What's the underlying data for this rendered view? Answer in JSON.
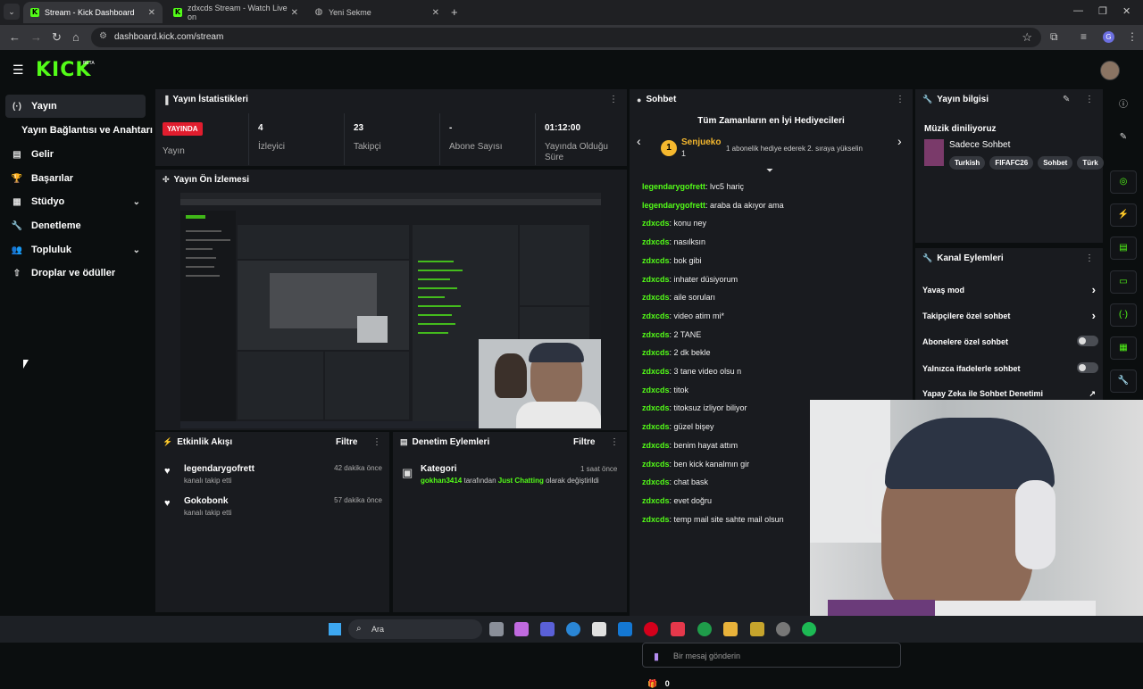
{
  "browser": {
    "tabs": [
      {
        "title": "Stream - Kick Dashboard",
        "active": true
      },
      {
        "title": "zdxcds Stream - Watch Live on",
        "active": false
      },
      {
        "title": "Yeni Sekme",
        "active": false
      }
    ],
    "url": "dashboard.kick.com/stream",
    "profile_initial": "G"
  },
  "brand": {
    "logo": "KICK",
    "beta": "BETA"
  },
  "sidebar": {
    "items": [
      {
        "label": "Yayın",
        "icon": "(·)"
      },
      {
        "label": "Yayın Bağlantısı ve Anahtarı",
        "icon": ""
      },
      {
        "label": "Gelir",
        "icon": "▤"
      },
      {
        "label": "Başarılar",
        "icon": "🏆"
      },
      {
        "label": "Stüdyo",
        "icon": "▦"
      },
      {
        "label": "Denetleme",
        "icon": "🔧"
      },
      {
        "label": "Topluluk",
        "icon": "👥"
      },
      {
        "label": "Droplar ve ödüller",
        "icon": "⇧"
      }
    ]
  },
  "stats": {
    "title": "Yayın İstatistikleri",
    "live_badge": "YAYINDA",
    "live_label": "Yayın",
    "items": [
      {
        "value": "4",
        "label": "İzleyici"
      },
      {
        "value": "23",
        "label": "Takipçi"
      },
      {
        "value": "-",
        "label": "Abone Sayısı"
      },
      {
        "value": "01:12:00",
        "label": "Yayında Olduğu Süre"
      }
    ]
  },
  "preview": {
    "title": "Yayın Ön İzlemesi"
  },
  "activity": {
    "title": "Etkinlik Akışı",
    "filter": "Filtre",
    "items": [
      {
        "name": "legendarygofrett",
        "sub": "kanalı takip etti",
        "time": "42 dakika önce"
      },
      {
        "name": "Gokobonk",
        "sub": "kanalı takip etti",
        "time": "57 dakika önce"
      }
    ]
  },
  "moderation": {
    "title": "Denetim Eylemleri",
    "filter": "Filtre",
    "item": {
      "label": "Kategori",
      "time": "1 saat önce",
      "user": "gokhan3414",
      "middle": "tarafından",
      "category": "Just Chatting",
      "suffix": "olarak değiştirildi"
    }
  },
  "chat": {
    "title": "Sohbet",
    "top_gifters": "Tüm Zamanların en İyi Hediyecileri",
    "gifter": {
      "rank": "1",
      "name": "Senjueko",
      "count": "1"
    },
    "gifter_msg": "1 abonelik hediye ederek 2. sıraya yükselin",
    "messages": [
      {
        "user": "legendarygofrett",
        "text": "lvc5 hariç"
      },
      {
        "user": "legendarygofrett",
        "text": "araba da akıyor ama"
      },
      {
        "user": "zdxcds",
        "text": "konu ney"
      },
      {
        "user": "zdxcds",
        "text": "nasılksın"
      },
      {
        "user": "zdxcds",
        "text": "bok gibi"
      },
      {
        "user": "zdxcds",
        "text": "inhater düsiyorum"
      },
      {
        "user": "zdxcds",
        "text": "aile soruları"
      },
      {
        "user": "zdxcds",
        "text": "video atim mi*"
      },
      {
        "user": "zdxcds",
        "text": "2 TANE"
      },
      {
        "user": "zdxcds",
        "text": "2 dk bekle"
      },
      {
        "user": "zdxcds",
        "text": "3 tane video olsu n"
      },
      {
        "user": "zdxcds",
        "text": "titok"
      },
      {
        "user": "zdxcds",
        "text": "titoksuz izliyor biliyor"
      },
      {
        "user": "zdxcds",
        "text": "güzel bişey"
      },
      {
        "user": "zdxcds",
        "text": "benim hayat attım"
      },
      {
        "user": "zdxcds",
        "text": "ben kick kanalmın gir"
      },
      {
        "user": "zdxcds",
        "text": "chat bask"
      },
      {
        "user": "zdxcds",
        "text": "evet doğru"
      },
      {
        "user": "zdxcds",
        "text": "temp mail site sahte mail olsun"
      }
    ],
    "input_placeholder": "Bir mesaj gönderin",
    "gift_count": "0"
  },
  "stream_info": {
    "title": "Yayın bilgisi",
    "stream_title": "Müzik diniliyoruz",
    "category": "Sadece Sohbet",
    "tags": [
      "Turkish",
      "FIFAFC26",
      "Sohbet",
      "Türk"
    ]
  },
  "channel_actions": {
    "title": "Kanal Eylemleri",
    "items": [
      {
        "label": "Yavaş mod",
        "kind": "arrow"
      },
      {
        "label": "Takipçilere özel sohbet",
        "kind": "arrow"
      },
      {
        "label": "Abonelere özel sohbet",
        "kind": "toggle"
      },
      {
        "label": "Yalnızca ifadelerle sohbet",
        "kind": "toggle"
      },
      {
        "label": "Yapay Zeka ile Sohbet Denetimi",
        "kind": "external"
      }
    ]
  },
  "taskbar": {
    "search": "Ara"
  },
  "colors": {
    "accent": "#53fc18",
    "live": "#e11d2e",
    "panel": "#191b1f",
    "gold": "#f5b82e"
  }
}
